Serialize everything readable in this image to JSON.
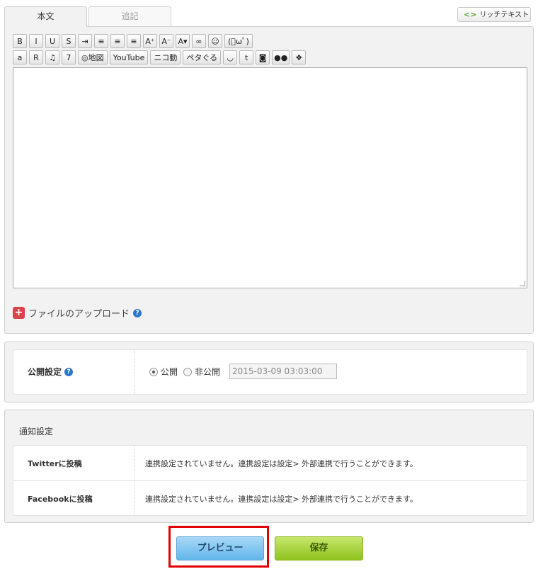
{
  "tabs": {
    "main": "本文",
    "extra": "追記"
  },
  "rich_text_label": "リッチテキスト",
  "toolbar": {
    "row1": [
      {
        "name": "bold-button",
        "glyph": "B"
      },
      {
        "name": "italic-button",
        "glyph": "I"
      },
      {
        "name": "underline-button",
        "glyph": "U"
      },
      {
        "name": "strikethrough-button",
        "glyph": "S"
      },
      {
        "name": "indent-button",
        "glyph": "⇥"
      },
      {
        "name": "align-left-button",
        "glyph": "≡"
      },
      {
        "name": "align-center-button",
        "glyph": "≡"
      },
      {
        "name": "align-right-button",
        "glyph": "≡"
      },
      {
        "name": "font-larger-button",
        "glyph": "A⁺"
      },
      {
        "name": "font-smaller-button",
        "glyph": "A⁻"
      },
      {
        "name": "font-color-button",
        "glyph": "A▾"
      },
      {
        "name": "link-button",
        "glyph": "∞"
      },
      {
        "name": "emoji-button",
        "glyph": "☺"
      },
      {
        "name": "kaomoji-button",
        "glyph": "(ﾟωﾟ)"
      }
    ],
    "row2": [
      {
        "name": "amazon-button",
        "glyph": "a"
      },
      {
        "name": "rakuten-button",
        "glyph": "R"
      },
      {
        "name": "music-button",
        "glyph": "♫"
      },
      {
        "name": "7net-button",
        "glyph": "7"
      },
      {
        "name": "map-button",
        "glyph": "◎地図"
      },
      {
        "name": "youtube-button",
        "glyph": "YouTube"
      },
      {
        "name": "niconico-button",
        "glyph": "ニコ動"
      },
      {
        "name": "petagoro-button",
        "glyph": "ペタぐる"
      },
      {
        "name": "smile-button",
        "glyph": "◡"
      },
      {
        "name": "twitter-button",
        "glyph": "t"
      },
      {
        "name": "instagram-button",
        "glyph": "◙"
      },
      {
        "name": "flickr-button",
        "glyph": "●●"
      },
      {
        "name": "dropbox-button",
        "glyph": "❖"
      }
    ]
  },
  "upload": {
    "label": "ファイルのアップロード"
  },
  "publish": {
    "label": "公開設定",
    "public_label": "公開",
    "private_label": "非公開",
    "datetime_value": "2015-03-09 03:03:00",
    "selected": "public"
  },
  "notification": {
    "title": "通知設定",
    "rows": [
      {
        "label": "Twitterに投稿",
        "message": "連携設定されていません。連携設定は設定> 外部連携で行うことができます。"
      },
      {
        "label": "Facebookに投稿",
        "message": "連携設定されていません。連携設定は設定> 外部連携で行うことができます。"
      }
    ]
  },
  "buttons": {
    "preview": "プレビュー",
    "save": "保存"
  },
  "colors": {
    "preview_blue": "#62b6ea",
    "save_green": "#8fc31f",
    "highlight_red": "#e00000",
    "upload_red": "#d9434e"
  }
}
